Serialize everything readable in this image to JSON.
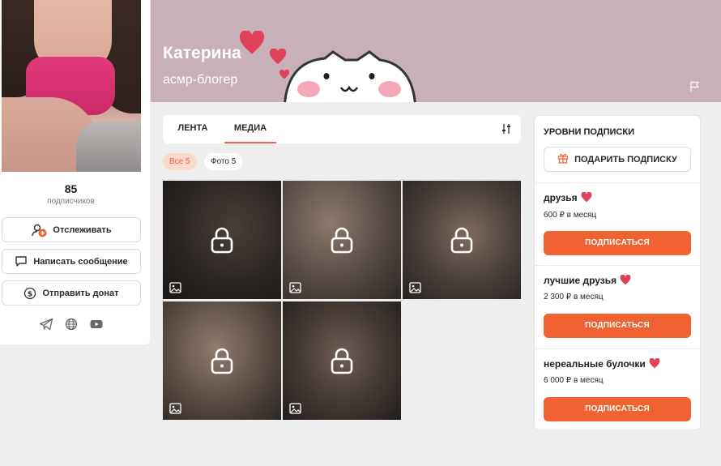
{
  "profile": {
    "name": "Катерина",
    "bio": "асмр-блогер",
    "subscribers_count": "85",
    "subscribers_label": "подписчиков"
  },
  "sidebar": {
    "follow_label": "Отслеживать",
    "message_label": "Написать сообщение",
    "donate_label": "Отправить донат",
    "social_icons": [
      "telegram-icon",
      "globe-icon",
      "youtube-icon"
    ]
  },
  "tabs": [
    {
      "label": "ЛЕНТА",
      "active": false
    },
    {
      "label": "МЕДИА",
      "active": true
    }
  ],
  "filters": [
    {
      "label": "Все 5",
      "active": true
    },
    {
      "label": "Фото 5",
      "active": false
    }
  ],
  "media": {
    "tiles": [
      {
        "locked": true
      },
      {
        "locked": true
      },
      {
        "locked": true
      },
      {
        "locked": true
      },
      {
        "locked": true
      }
    ]
  },
  "levels": {
    "title": "УРОВНИ ПОДПИСКИ",
    "gift_label": "ПОДАРИТЬ ПОДПИСКУ",
    "tiers": [
      {
        "name": "друзья",
        "price": "600 ₽ в месяц",
        "button": "ПОДПИСАТЬСЯ"
      },
      {
        "name": "лучшие друзья",
        "price": "2 300 ₽ в месяц",
        "button": "ПОДПИСАТЬСЯ"
      },
      {
        "name": "нереальные булочки",
        "price": "6 000 ₽ в месяц",
        "button": "ПОДПИСАТЬСЯ"
      }
    ]
  },
  "colors": {
    "accent": "#f06231",
    "banner": "#c8b0b8",
    "heart": "#e0425a"
  }
}
